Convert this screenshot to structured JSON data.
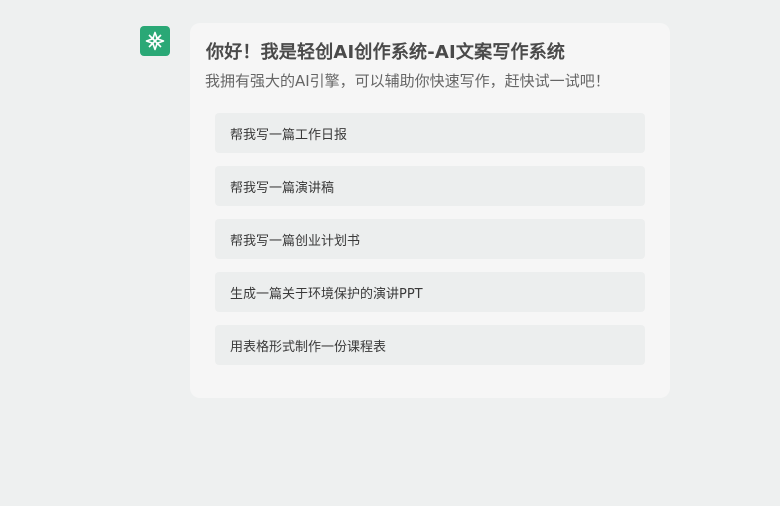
{
  "assistant": {
    "avatar_icon": "ai-logo-icon",
    "avatar_color": "#2aa876"
  },
  "welcome": {
    "title": "你好！我是轻创AI创作系统-AI文案写作系统",
    "subtitle": "我拥有强大的AI引擎，可以辅助你快速写作，赶快试一试吧！"
  },
  "suggestions": [
    {
      "label": "帮我写一篇工作日报"
    },
    {
      "label": "帮我写一篇演讲稿"
    },
    {
      "label": "帮我写一篇创业计划书"
    },
    {
      "label": "生成一篇关于环境保护的演讲PPT"
    },
    {
      "label": "用表格形式制作一份课程表"
    }
  ]
}
